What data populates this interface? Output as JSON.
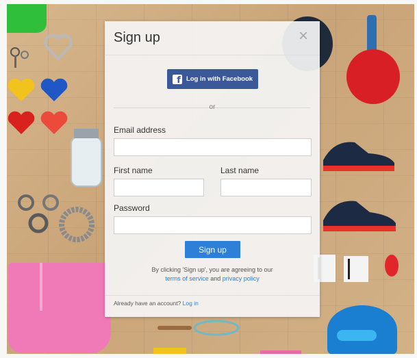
{
  "modal": {
    "title": "Sign up",
    "close_glyph": "×"
  },
  "facebook": {
    "label": "Log in with Facebook",
    "icon_glyph": "f",
    "color": "#3b5998"
  },
  "divider_text": "or",
  "form": {
    "email_label": "Email address",
    "email_value": "",
    "first_name_label": "First name",
    "first_name_value": "",
    "last_name_label": "Last name",
    "last_name_value": "",
    "password_label": "Password",
    "password_value": "",
    "submit_label": "Sign up",
    "submit_color": "#2d7fd8"
  },
  "terms": {
    "prefix": "By clicking 'Sign up', you are agreeing to our",
    "tos_link": "terms of service",
    "and": "and",
    "privacy_link": "privacy policy"
  },
  "footer": {
    "prompt": "Already have an account?",
    "login_link": "Log in"
  },
  "icons": {
    "close": "close-icon",
    "facebook": "facebook-icon"
  }
}
